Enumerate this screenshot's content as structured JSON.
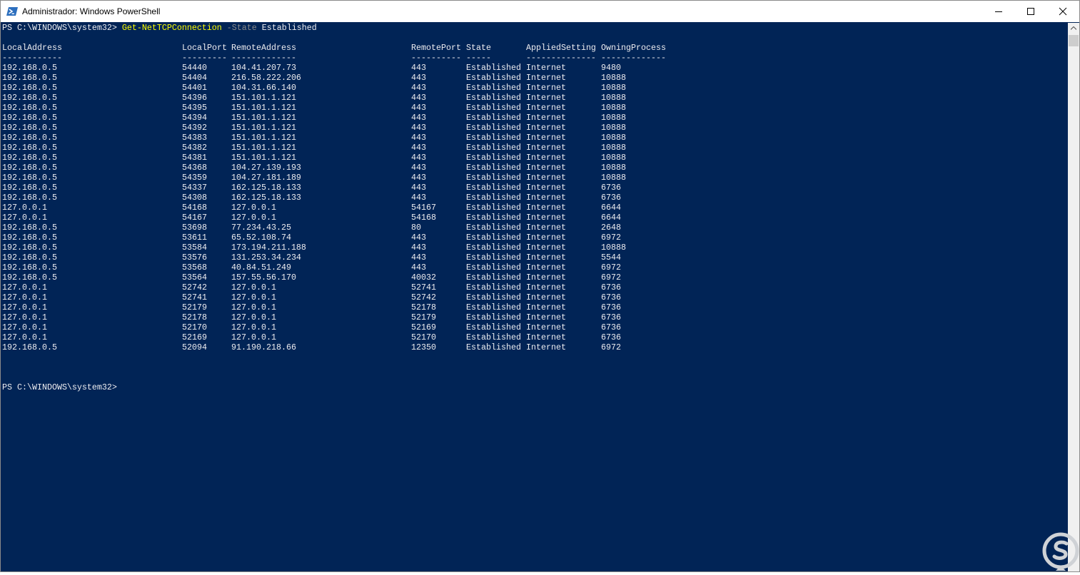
{
  "window": {
    "title": "Administrador: Windows PowerShell"
  },
  "console": {
    "prompt": "PS C:\\WINDOWS\\system32> ",
    "command": "Get-NetTCPConnection",
    "parameter": " -State",
    "argument": " Established",
    "final_prompt": "PS C:\\WINDOWS\\system32>",
    "table": {
      "headers": [
        "LocalAddress",
        "LocalPort",
        "RemoteAddress",
        "RemotePort",
        "State",
        "AppliedSetting",
        "OwningProcess"
      ],
      "dashes": [
        "------------",
        "---------",
        "-------------",
        "----------",
        "-----",
        "--------------",
        "-------------"
      ],
      "rows": [
        [
          "192.168.0.5",
          "54440",
          "104.41.207.73",
          "443",
          "Established",
          "Internet",
          "9480"
        ],
        [
          "192.168.0.5",
          "54404",
          "216.58.222.206",
          "443",
          "Established",
          "Internet",
          "10888"
        ],
        [
          "192.168.0.5",
          "54401",
          "104.31.66.140",
          "443",
          "Established",
          "Internet",
          "10888"
        ],
        [
          "192.168.0.5",
          "54396",
          "151.101.1.121",
          "443",
          "Established",
          "Internet",
          "10888"
        ],
        [
          "192.168.0.5",
          "54395",
          "151.101.1.121",
          "443",
          "Established",
          "Internet",
          "10888"
        ],
        [
          "192.168.0.5",
          "54394",
          "151.101.1.121",
          "443",
          "Established",
          "Internet",
          "10888"
        ],
        [
          "192.168.0.5",
          "54392",
          "151.101.1.121",
          "443",
          "Established",
          "Internet",
          "10888"
        ],
        [
          "192.168.0.5",
          "54383",
          "151.101.1.121",
          "443",
          "Established",
          "Internet",
          "10888"
        ],
        [
          "192.168.0.5",
          "54382",
          "151.101.1.121",
          "443",
          "Established",
          "Internet",
          "10888"
        ],
        [
          "192.168.0.5",
          "54381",
          "151.101.1.121",
          "443",
          "Established",
          "Internet",
          "10888"
        ],
        [
          "192.168.0.5",
          "54368",
          "104.27.139.193",
          "443",
          "Established",
          "Internet",
          "10888"
        ],
        [
          "192.168.0.5",
          "54359",
          "104.27.181.189",
          "443",
          "Established",
          "Internet",
          "10888"
        ],
        [
          "192.168.0.5",
          "54337",
          "162.125.18.133",
          "443",
          "Established",
          "Internet",
          "6736"
        ],
        [
          "192.168.0.5",
          "54308",
          "162.125.18.133",
          "443",
          "Established",
          "Internet",
          "6736"
        ],
        [
          "127.0.0.1",
          "54168",
          "127.0.0.1",
          "54167",
          "Established",
          "Internet",
          "6644"
        ],
        [
          "127.0.0.1",
          "54167",
          "127.0.0.1",
          "54168",
          "Established",
          "Internet",
          "6644"
        ],
        [
          "192.168.0.5",
          "53698",
          "77.234.43.25",
          "80",
          "Established",
          "Internet",
          "2648"
        ],
        [
          "192.168.0.5",
          "53611",
          "65.52.108.74",
          "443",
          "Established",
          "Internet",
          "6972"
        ],
        [
          "192.168.0.5",
          "53584",
          "173.194.211.188",
          "443",
          "Established",
          "Internet",
          "10888"
        ],
        [
          "192.168.0.5",
          "53576",
          "131.253.34.234",
          "443",
          "Established",
          "Internet",
          "5544"
        ],
        [
          "192.168.0.5",
          "53568",
          "40.84.51.249",
          "443",
          "Established",
          "Internet",
          "6972"
        ],
        [
          "192.168.0.5",
          "53564",
          "157.55.56.170",
          "40032",
          "Established",
          "Internet",
          "6972"
        ],
        [
          "127.0.0.1",
          "52742",
          "127.0.0.1",
          "52741",
          "Established",
          "Internet",
          "6736"
        ],
        [
          "127.0.0.1",
          "52741",
          "127.0.0.1",
          "52742",
          "Established",
          "Internet",
          "6736"
        ],
        [
          "127.0.0.1",
          "52179",
          "127.0.0.1",
          "52178",
          "Established",
          "Internet",
          "6736"
        ],
        [
          "127.0.0.1",
          "52178",
          "127.0.0.1",
          "52179",
          "Established",
          "Internet",
          "6736"
        ],
        [
          "127.0.0.1",
          "52170",
          "127.0.0.1",
          "52169",
          "Established",
          "Internet",
          "6736"
        ],
        [
          "127.0.0.1",
          "52169",
          "127.0.0.1",
          "52170",
          "Established",
          "Internet",
          "6736"
        ],
        [
          "192.168.0.5",
          "52094",
          "91.190.218.66",
          "12350",
          "Established",
          "Internet",
          "6972"
        ]
      ]
    }
  },
  "colors": {
    "console_bg": "#012456",
    "console_fg": "#eeedf0",
    "command": "#ffff00",
    "parameter": "#8a8a8a"
  },
  "icons": {
    "app": "powershell-icon",
    "minimize": "minimize-icon",
    "maximize": "maximize-icon",
    "close": "close-icon",
    "scroll_up": "chevron-up-icon",
    "watermark": "watermark-logo-icon"
  }
}
